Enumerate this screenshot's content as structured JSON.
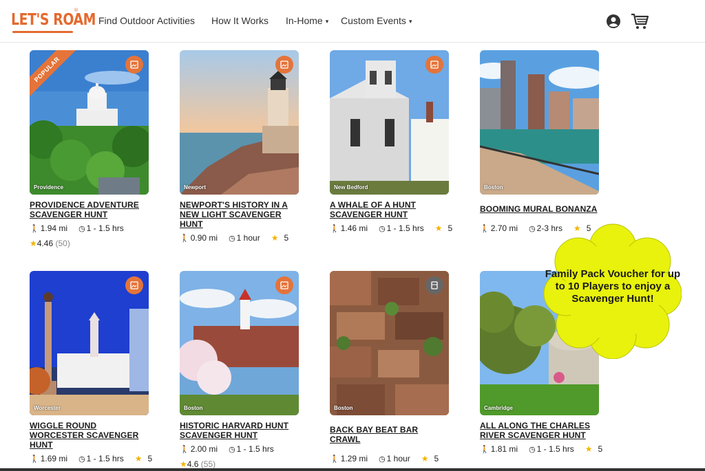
{
  "brand": {
    "name": "LET'S ROAM",
    "reg": "®",
    "color": "#e46a2e"
  },
  "nav": [
    {
      "label": "Find Outdoor Activities"
    },
    {
      "label": "How It Works"
    },
    {
      "label": "In-Home",
      "dropdown": true
    },
    {
      "label": "Custom Events",
      "dropdown": true
    }
  ],
  "caret": "▾",
  "header_icons": [
    "user-icon",
    "cart-icon"
  ],
  "cards": [
    {
      "city": "Providence",
      "title": "PROVIDENCE ADVENTURE SCAVENGER HUNT",
      "distance": "1.94 mi",
      "duration": "1 - 1.5 hrs",
      "rating": "4.46",
      "reviews": "(50)",
      "ribbon": "POPULAR"
    },
    {
      "city": "Newport",
      "title": "NEWPORT'S HISTORY IN A NEW LIGHT SCAVENGER HUNT",
      "distance": "0.90 mi",
      "duration": "1 hour",
      "rating": "5"
    },
    {
      "city": "New Bedford",
      "title": "A WHALE OF A HUNT SCAVENGER HUNT",
      "distance": "1.46 mi",
      "duration": "1 - 1.5 hrs",
      "rating": "5"
    },
    {
      "city": "Boston",
      "title": "BOOMING MURAL BONANZA",
      "distance": "2.70 mi",
      "duration": "2-3 hrs",
      "rating": "5"
    },
    {
      "city": "Worcester",
      "title": "WIGGLE ROUND WORCESTER SCAVENGER HUNT",
      "distance": "1.69 mi",
      "duration": "1 - 1.5 hrs",
      "rating": "5"
    },
    {
      "city": "Boston",
      "title": "HISTORIC HARVARD HUNT SCAVENGER HUNT",
      "distance": "2.00 mi",
      "duration": "1 - 1.5 hrs",
      "rating": "4.6",
      "reviews": "(55)"
    },
    {
      "city": "Boston",
      "title": "BACK BAY BEAT BAR CRAWL",
      "distance": "1.29 mi",
      "duration": "1 hour",
      "rating": "5"
    },
    {
      "city": "Cambridge",
      "title": "ALL ALONG THE CHARLES RIVER SCAVENGER HUNT",
      "distance": "1.81 mi",
      "duration": "1 - 1.5 hrs",
      "rating": "5"
    }
  ],
  "promo": {
    "text": "Family Pack Voucher for up to 10 Players to enjoy a Scavenger Hunt!",
    "color": "#e8f20c"
  },
  "accent": "#e4743a",
  "star_color": "#f3b400"
}
